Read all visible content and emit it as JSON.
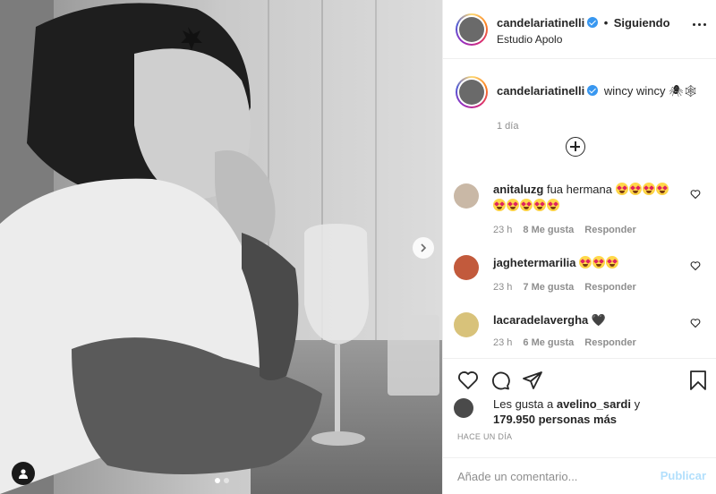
{
  "post": {
    "author": "candelariatinelli",
    "follow_separator": "•",
    "follow_status": "Siguiendo",
    "location": "Estudio Apolo",
    "caption": "wincy wincy 🕷🕸",
    "caption_time": "1 día"
  },
  "comments": [
    {
      "user": "anitaluzg",
      "text": "fua hermana",
      "emoji_count": 9,
      "time": "23 h",
      "likes": "8 Me gusta",
      "reply": "Responder"
    },
    {
      "user": "jaghetermarilia",
      "text": "",
      "emoji_count": 3,
      "time": "23 h",
      "likes": "7 Me gusta",
      "reply": "Responder"
    },
    {
      "user": "lacaradelavergha",
      "text": "🖤",
      "emoji_count": 0,
      "time": "23 h",
      "likes": "6 Me gusta",
      "reply": "Responder"
    }
  ],
  "likes": {
    "prefix": "Les gusta a",
    "user": "avelino_sardi",
    "connector": "y",
    "count": "179.950 personas más"
  },
  "posted_ago": "HACE UN DÍA",
  "composer": {
    "placeholder": "Añade un comentario...",
    "publish": "Publicar"
  },
  "carousel": {
    "slides": 2,
    "current": 1
  },
  "colors": {
    "verified": "#3897f0",
    "publish_disabled": "#b2dffc",
    "muted": "#8e8e8e"
  }
}
